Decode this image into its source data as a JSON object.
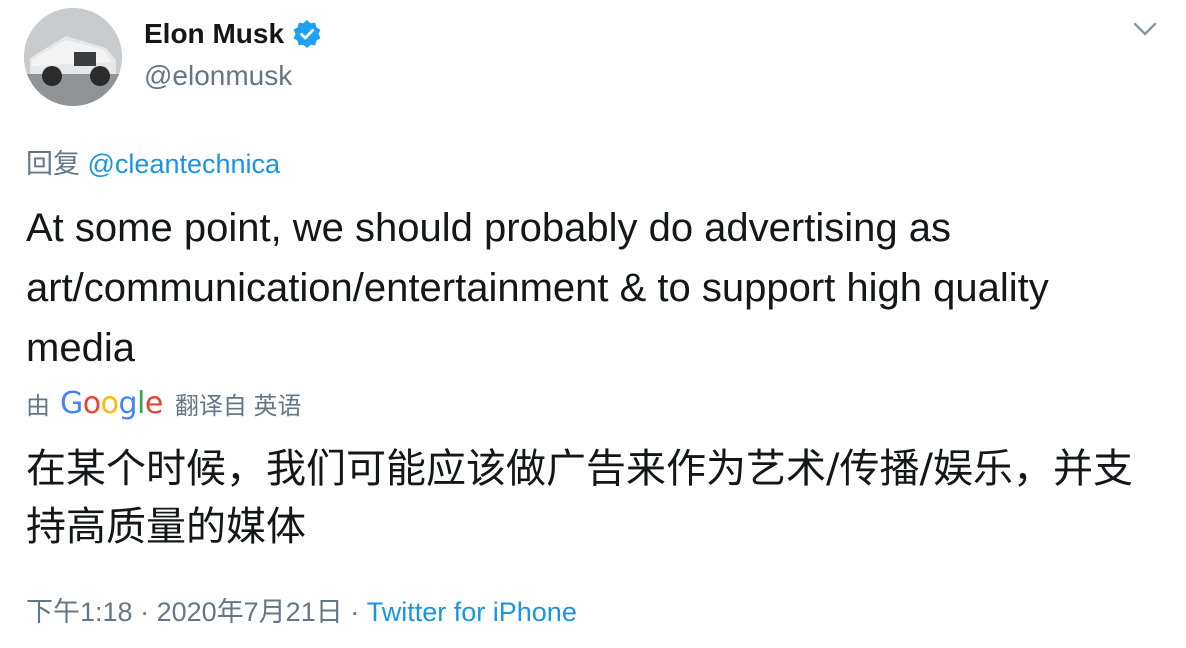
{
  "tweet": {
    "author_name": "Elon Musk",
    "author_handle": "@elonmusk",
    "verified": true,
    "replying_prefix": "回复",
    "replying_to": "@cleantechnica",
    "text": "At some point, we should probably do advertising as art/communication/entertainment & to support high quality media",
    "translated_by_prefix": "由",
    "translated_by_provider": "Google",
    "translated_from": "翻译自 英语",
    "translated_text": "在某个时候，我们可能应该做广告来作为艺术/传播/娱乐，并支持高质量的媒体",
    "time": "下午1:18",
    "separator": "·",
    "date": "2020年7月21日",
    "source": "Twitter for iPhone"
  },
  "colors": {
    "text": "#14171a",
    "secondary": "#657786",
    "link": "#1b95e0",
    "verified": "#1da1f2"
  },
  "icons": {
    "verified": "verified-badge-icon",
    "menu": "chevron-down-icon"
  }
}
